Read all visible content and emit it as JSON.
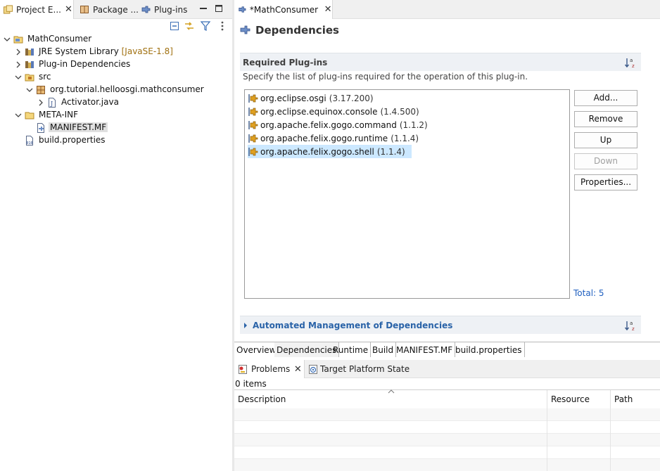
{
  "left_view": {
    "tabs": [
      {
        "label": "Project E...",
        "active": true,
        "closable": true
      },
      {
        "label": "Package ...",
        "active": false
      },
      {
        "label": "Plug-ins",
        "active": false
      }
    ],
    "tree": [
      {
        "label": "MathConsumer",
        "decoration": "",
        "icon": "project-icon",
        "expanded": true
      },
      {
        "label": "JRE System Library",
        "decoration": "[JavaSE-1.8]",
        "icon": "library-icon",
        "expanded": false
      },
      {
        "label": "Plug-in Dependencies",
        "decoration": "",
        "icon": "library-icon",
        "expanded": false
      },
      {
        "label": "src",
        "decoration": "",
        "icon": "source-folder-icon",
        "expanded": true
      },
      {
        "label": "org.tutorial.helloosgi.mathconsumer",
        "decoration": "",
        "icon": "package-icon",
        "expanded": true
      },
      {
        "label": "Activator.java",
        "decoration": "",
        "icon": "java-file-icon",
        "expanded": false
      },
      {
        "label": "META-INF",
        "decoration": "",
        "icon": "folder-icon",
        "expanded": true
      },
      {
        "label": "MANIFEST.MF",
        "decoration": "",
        "icon": "manifest-file-icon",
        "selected": true
      },
      {
        "label": "build.properties",
        "decoration": "",
        "icon": "properties-file-icon"
      }
    ]
  },
  "editor": {
    "tab_label": "*MathConsumer",
    "page_title": "Dependencies",
    "required_section": {
      "title": "Required Plug-ins",
      "description": "Specify the list of plug-ins required for the operation of this plug-in.",
      "plugins": [
        {
          "name": "org.eclipse.osgi",
          "version": "(3.17.200)"
        },
        {
          "name": "org.eclipse.equinox.console",
          "version": "(1.4.500)"
        },
        {
          "name": "org.apache.felix.gogo.command",
          "version": "(1.1.2)"
        },
        {
          "name": "org.apache.felix.gogo.runtime",
          "version": "(1.1.4)"
        },
        {
          "name": "org.apache.felix.gogo.shell",
          "version": "(1.1.4)",
          "selected": true
        }
      ],
      "buttons": {
        "add": "Add...",
        "remove": "Remove",
        "up": "Up",
        "down": "Down",
        "properties": "Properties..."
      },
      "total": "Total: 5"
    },
    "automated_section": {
      "title": "Automated Management of Dependencies"
    },
    "page_tabs": [
      "Overview",
      "Dependencies",
      "Runtime",
      "Build",
      "MANIFEST.MF",
      "build.properties"
    ],
    "active_page_tab": "Dependencies"
  },
  "problems_view": {
    "tabs": [
      {
        "label": "Problems",
        "active": true,
        "closable": true
      },
      {
        "label": "Target Platform State",
        "active": false
      }
    ],
    "items_count": "0 items",
    "columns": [
      "Description",
      "Resource",
      "Path"
    ]
  },
  "colors": {
    "selection": "#cce8ff",
    "section_header_bg": "#eef1f5",
    "link_blue": "#2a63a8"
  }
}
